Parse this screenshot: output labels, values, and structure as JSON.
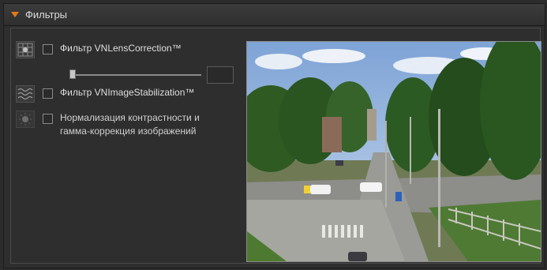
{
  "panel": {
    "title": "Фильтры"
  },
  "filters": {
    "lens_correction": {
      "label": "Фильтр VNLensCorrection™",
      "checked": false,
      "slider_level": 0.0
    },
    "stabilization": {
      "label": "Фильтр VNImageStabilization™",
      "checked": false
    },
    "normalization": {
      "label_line1": "Нормализация контрастности и",
      "label_line2": "гамма-коррекция изображений",
      "checked": false
    }
  },
  "colors": {
    "accent": "#e07b1a",
    "panel_bg": "#2e2e2e",
    "text": "#dedede"
  },
  "icons": {
    "lens": "grid-lens-icon",
    "stabilization": "wave-icon",
    "normalization": "sun-icon",
    "collapse": "triangle-down-icon"
  }
}
